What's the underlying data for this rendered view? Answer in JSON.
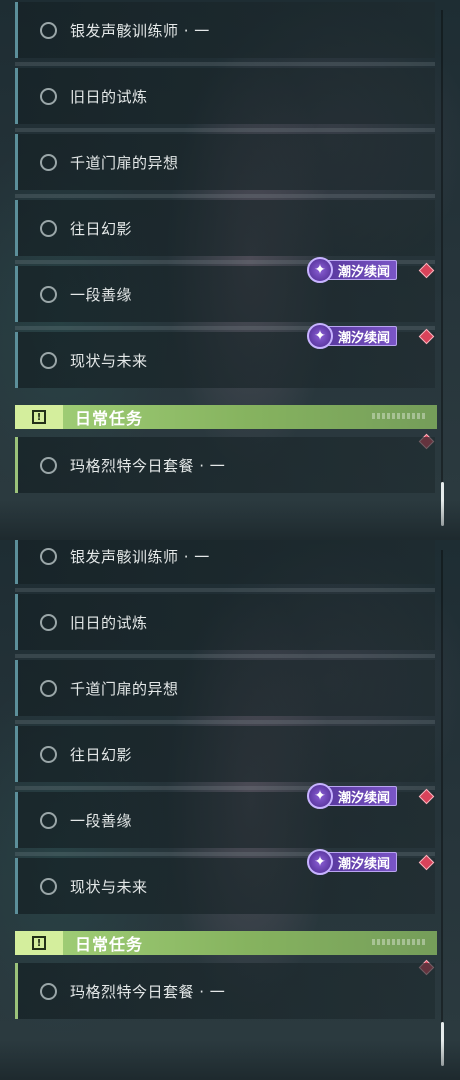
{
  "panels": [
    {
      "quests": [
        {
          "label": "银发声骸训练师 · 一"
        },
        {
          "label": "旧日的试炼"
        },
        {
          "label": "千道门扉的异想"
        },
        {
          "label": "往日幻影"
        },
        {
          "label": "一段善缘"
        },
        {
          "label": "现状与未来"
        }
      ],
      "badges": [
        {
          "label": "潮汐续闻"
        },
        {
          "label": "潮汐续闻"
        }
      ],
      "daily": {
        "header_title": "日常任务",
        "header_icon": "!",
        "quest_label": "玛格烈特今日套餐 · 一"
      }
    },
    {
      "quests": [
        {
          "label": "银发声骸训练师 · 一"
        },
        {
          "label": "旧日的试炼"
        },
        {
          "label": "千道门扉的异想"
        },
        {
          "label": "往日幻影"
        },
        {
          "label": "一段善缘"
        },
        {
          "label": "现状与未来"
        }
      ],
      "badges": [
        {
          "label": "潮汐续闻"
        },
        {
          "label": "潮汐续闻"
        }
      ],
      "daily": {
        "header_title": "日常任务",
        "header_icon": "!",
        "quest_label": "玛格烈特今日套餐 · 一"
      }
    }
  ],
  "icons": {
    "quest_status": "circle-outline-icon",
    "badge": "tide-sparkle-icon",
    "new_marker": "red-diamond-icon",
    "daily_header": "alert-square-icon"
  },
  "colors": {
    "badge_purple": "#7a55c6",
    "daily_green": "#a4d27a",
    "marker_red": "#d8435a",
    "row_accent": "#5c8f9a"
  }
}
